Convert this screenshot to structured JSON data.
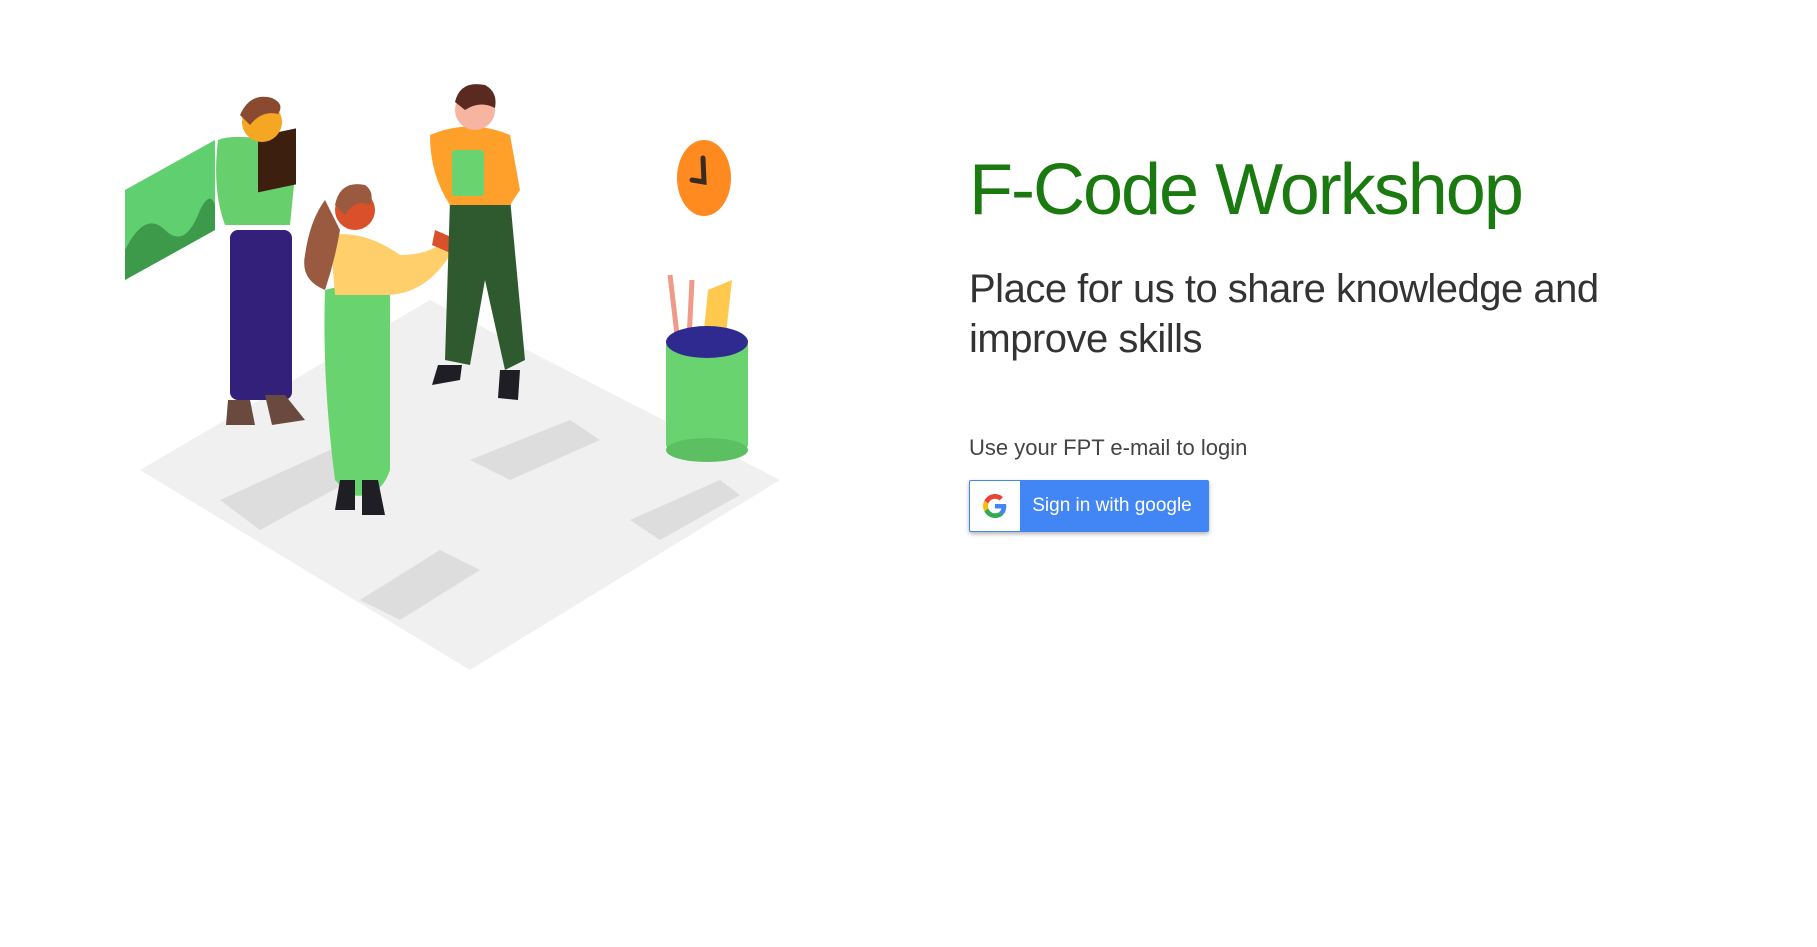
{
  "hero": {
    "title": "F-Code Workshop",
    "subtitle": "Place for us to share knowledge and improve skills"
  },
  "login": {
    "hint": "Use your FPT e-mail to login",
    "google_button_label": "Sign in with google",
    "google_icon": "google-g-icon"
  },
  "colors": {
    "title": "#1a7a10",
    "google_blue": "#4285f4",
    "text_dark": "#333333"
  },
  "illustration": {
    "subject": "team-collaboration-illustration"
  }
}
